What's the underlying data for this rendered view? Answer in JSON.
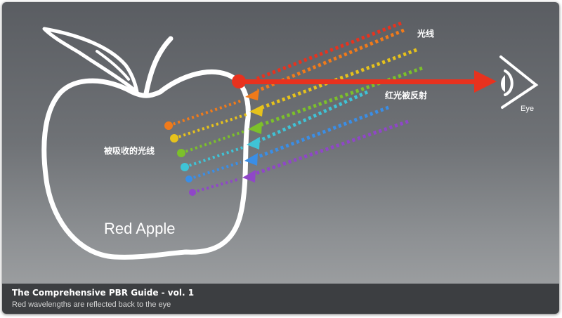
{
  "labels": {
    "incoming_light": "光线",
    "reflected_red": "红光被反射",
    "absorbed_light": "被吸收的光线",
    "apple": "Red Apple",
    "eye": "Eye"
  },
  "caption": {
    "title": "The Comprehensive PBR Guide - vol. 1",
    "subtitle": "Red wavelengths are reflected back to the eye"
  },
  "colors": {
    "red": "#e8321e",
    "orange": "#f07a1a",
    "yellow": "#e6c21c",
    "green": "#7cc02a",
    "cyan": "#3fc3d6",
    "blue": "#3a8ee6",
    "violet": "#8f47c8",
    "outline": "#ffffff",
    "caption_bar": "#3c3e41"
  },
  "icons": {
    "apple": "apple-outline-icon",
    "eye": "eye-icon"
  }
}
